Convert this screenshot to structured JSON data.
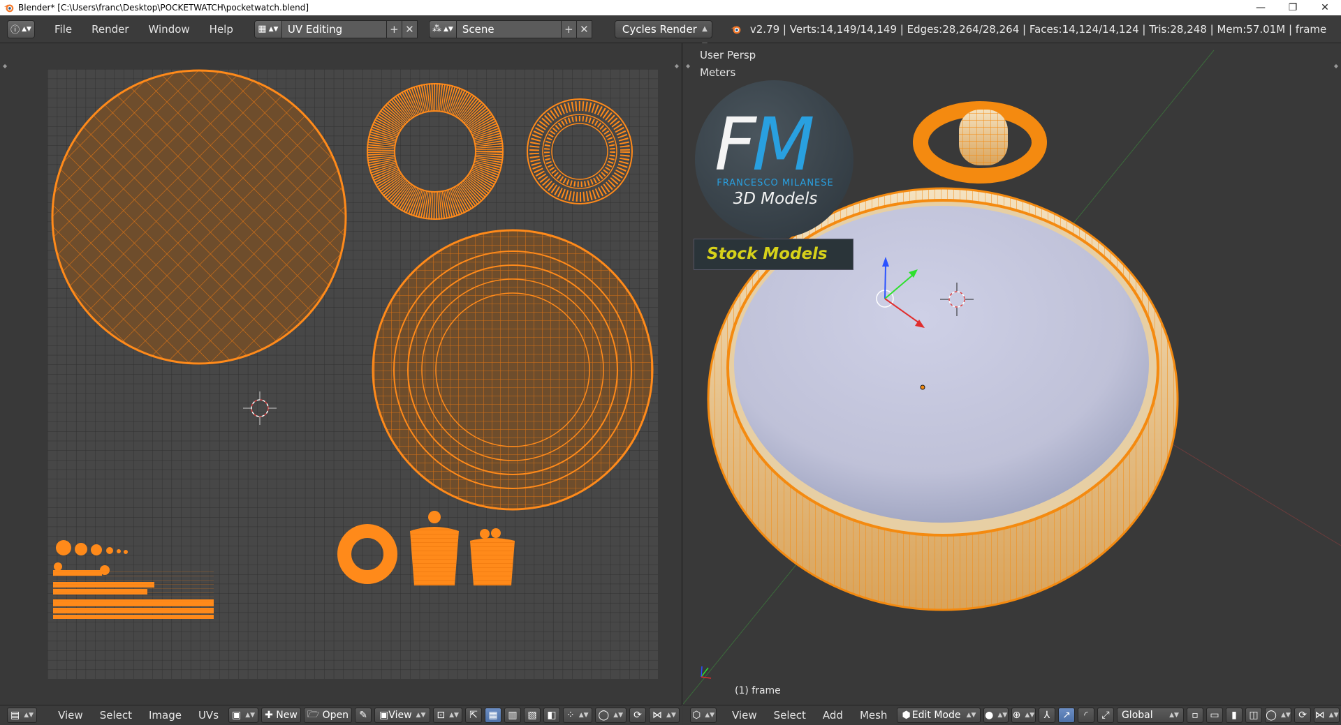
{
  "window": {
    "title": "Blender* [C:\\Users\\franc\\Desktop\\POCKETWATCH\\pocketwatch.blend]",
    "minimize": "—",
    "maximize": "❐",
    "close": "✕"
  },
  "info_header": {
    "editor_icon": "info-icon",
    "menu": [
      "File",
      "Render",
      "Window",
      "Help"
    ],
    "layout": {
      "icon": "screen-layout-icon",
      "name": "UV Editing",
      "add": "+",
      "remove": "✕"
    },
    "scene": {
      "icon": "scene-icon",
      "name": "Scene",
      "add": "+",
      "remove": "✕"
    },
    "render_engine": "Cycles Render",
    "stats": "v2.79 | Verts:14,149/14,149 | Edges:28,264/28,264 | Faces:14,124/14,124 | Tris:28,248 | Mem:57.01M | frame"
  },
  "uv_editor": {
    "footer": {
      "editor_icon": "image-editor-icon",
      "menus": [
        "View",
        "Select",
        "Image",
        "UVs"
      ],
      "new_label": "New",
      "open_label": "Open",
      "view_label": "View"
    }
  },
  "viewport": {
    "view_name": "User Persp",
    "units": "Meters",
    "object_label": "(1) frame",
    "watermark": {
      "initials": "FM",
      "author": "FRANCESCO MILANESE",
      "subtitle": "3D Models",
      "banner": "Stock Models"
    },
    "footer": {
      "editor_icon": "3d-view-icon",
      "menus": [
        "View",
        "Select",
        "Add",
        "Mesh"
      ],
      "mode": "Edit Mode",
      "orientation": "Global"
    }
  },
  "colors": {
    "uv_orange": "#ff8a1a",
    "wire_orange": "#f48a10",
    "panel_bg": "#393939",
    "header_bg": "#3b3b3b",
    "accent_blue": "#29a0e0",
    "banner_text": "#d7d21a"
  }
}
